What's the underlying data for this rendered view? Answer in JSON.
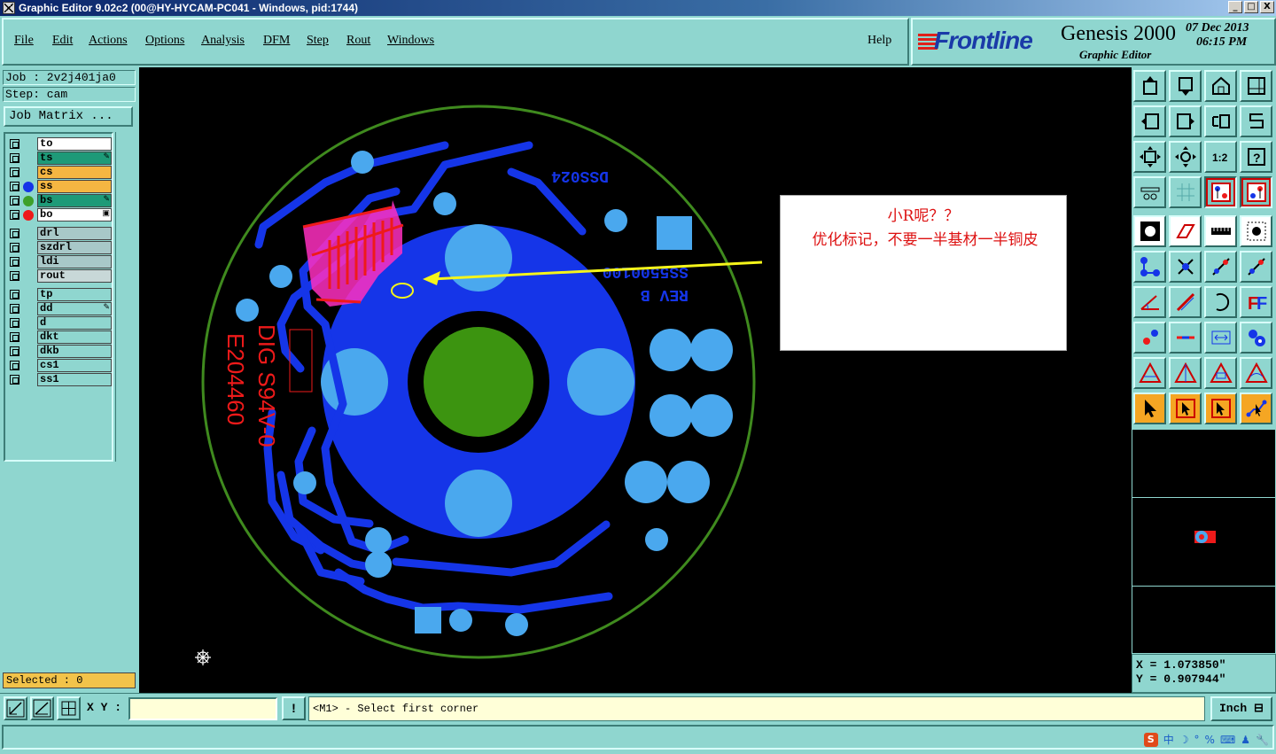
{
  "window": {
    "title": "Graphic Editor 9.02c2 (00@HY-HYCAM-PC041 - Windows, pid:1744)",
    "buttons": [
      "_",
      "□",
      "X"
    ]
  },
  "menu": {
    "items": [
      "File",
      "Edit",
      "Actions",
      "Options",
      "Analysis",
      "DFM",
      "Step",
      "Rout",
      "Windows"
    ],
    "help": "Help"
  },
  "brand": {
    "logo": "Frontline",
    "product": "Genesis 2000",
    "subtitle": "Graphic Editor",
    "date": "07 Dec 2013",
    "time": "06:15 PM"
  },
  "job": {
    "job_line": "Job : 2v2j401ja0",
    "step_line": "Step: cam",
    "matrix_button": "Job Matrix ..."
  },
  "layers": [
    {
      "name": "to",
      "bg": "#ffffff",
      "dot": null,
      "mark": ""
    },
    {
      "name": "ts",
      "bg": "#1e9a78",
      "dot": null,
      "mark": "✎"
    },
    {
      "name": "cs",
      "bg": "#f5b642",
      "dot": null,
      "mark": ""
    },
    {
      "name": "ss",
      "bg": "#f5b642",
      "dot": "#1535e8",
      "mark": ""
    },
    {
      "name": "bs",
      "bg": "#1e9a78",
      "dot": "#3da02a",
      "mark": "✎"
    },
    {
      "name": "bo",
      "bg": "#ffffff",
      "dot": "#ee1a1a",
      "mark": "▣"
    },
    {
      "name": "drl",
      "bg": "#a8c8c8",
      "dot": null,
      "mark": ""
    },
    {
      "name": "szdrl",
      "bg": "#a8c8c8",
      "dot": null,
      "mark": ""
    },
    {
      "name": "ldi",
      "bg": "#a8c8c8",
      "dot": null,
      "mark": ""
    },
    {
      "name": "rout",
      "bg": "#c8d8d8",
      "dot": null,
      "mark": ""
    },
    {
      "name": "tp",
      "bg": "#8fd6cf",
      "dot": null,
      "mark": ""
    },
    {
      "name": "dd",
      "bg": "#8fd6cf",
      "dot": null,
      "mark": "✎"
    },
    {
      "name": "d",
      "bg": "#8fd6cf",
      "dot": null,
      "mark": ""
    },
    {
      "name": "dkt",
      "bg": "#8fd6cf",
      "dot": null,
      "mark": ""
    },
    {
      "name": "dkb",
      "bg": "#8fd6cf",
      "dot": null,
      "mark": ""
    },
    {
      "name": "cs1",
      "bg": "#8fd6cf",
      "dot": null,
      "mark": ""
    },
    {
      "name": "ss1",
      "bg": "#8fd6cf",
      "dot": null,
      "mark": ""
    }
  ],
  "selected": "Selected : 0",
  "canvas": {
    "silk_top_text": "DSS024",
    "silk_mid_text1": "SS5500100",
    "silk_mid_text2": "REV B",
    "red_text1": "E204460",
    "red_text2": "DIG S94V-0",
    "colors": {
      "copper": "#1535e8",
      "pad": "#4aa8ee",
      "ring": "#3f8a1e",
      "center": "#3c9410",
      "silk": "#ee1a1a",
      "highlight": "#ff2fc0",
      "arrow": "#f5f51a"
    }
  },
  "callout": {
    "line1": "小R呢？？",
    "line2": "优化标记，不要一半基材一半铜皮"
  },
  "tools": {
    "icons": [
      "layer-up-icon",
      "layer-down-icon",
      "home-icon",
      "window-icon",
      "pan-left-icon",
      "pan-right-icon",
      "swap-icon",
      "snake-icon",
      "zoom-fit-icon",
      "zoom-center-icon",
      "scale-1-2-icon",
      "help-icon",
      "measure-icon",
      "grid-icon",
      "net-red-icon",
      "net-red2-icon",
      "feature-icon",
      "outline-icon",
      "ruler-icon",
      "select-area-icon",
      "connect-icon",
      "cross-icon",
      "line-dot-icon",
      "line-dot2-icon",
      "angle-icon",
      "diagonal-icon",
      "arc-icon",
      "text-f-icon",
      "pad-icon",
      "dash-icon",
      "dim-icon",
      "copper-icon",
      "triangle-icon",
      "triangle2-icon",
      "triangle3-icon",
      "triangle4-icon",
      "pointer-icon",
      "pointer-box-icon",
      "pointer-select-icon",
      "route-icon"
    ]
  },
  "coords": {
    "x": "X = 1.073850\"",
    "y": "Y = 0.907944\""
  },
  "bottom": {
    "xy_label": "X Y :",
    "xy_value": "",
    "prompt": "<M1> - Select first corner",
    "units": "Inch ⊟",
    "bang": "!"
  },
  "ime": {
    "brand": "S",
    "items": [
      "中",
      "☽",
      "°",
      "%",
      "⌨",
      "♟",
      "🔧"
    ]
  }
}
